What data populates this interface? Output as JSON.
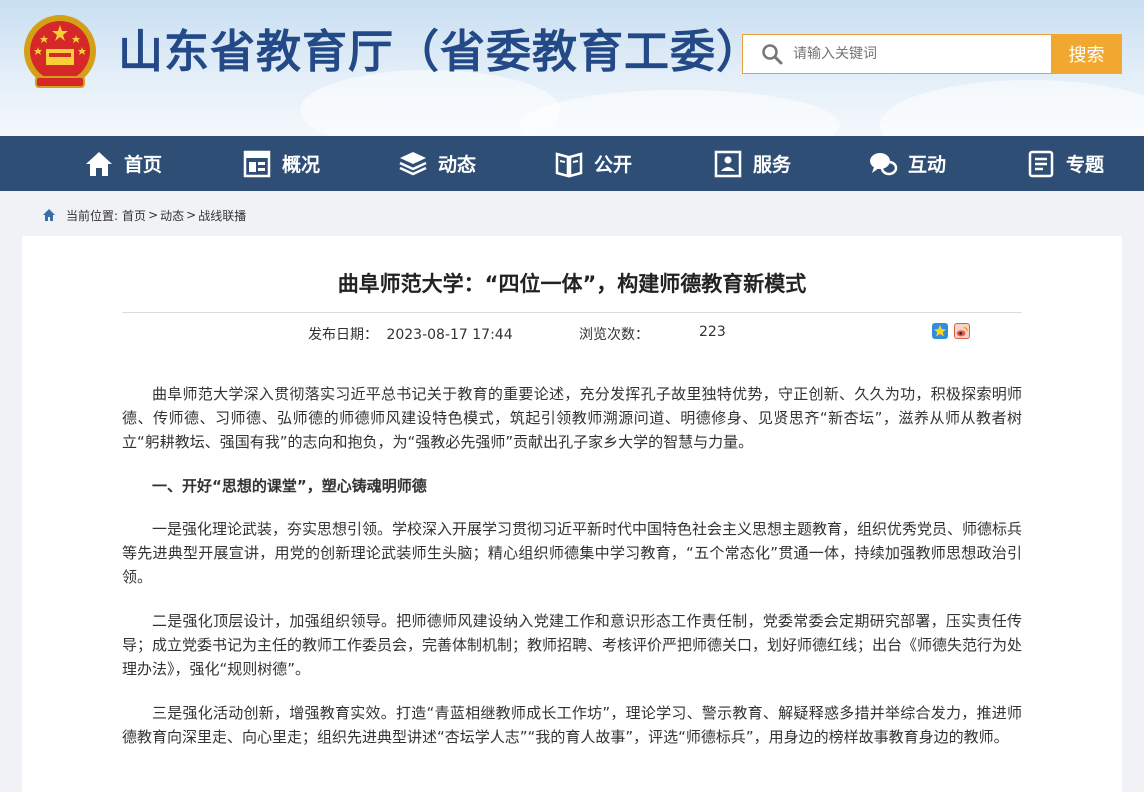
{
  "header": {
    "site_title": "山东省教育厅（省委教育工委）",
    "search": {
      "placeholder": "请输入关键词",
      "button_label": "搜索"
    }
  },
  "nav": {
    "items": [
      {
        "label": "首页",
        "icon": "home-icon"
      },
      {
        "label": "概况",
        "icon": "overview-icon"
      },
      {
        "label": "动态",
        "icon": "news-stack-icon"
      },
      {
        "label": "公开",
        "icon": "open-book-icon"
      },
      {
        "label": "服务",
        "icon": "service-doc-icon"
      },
      {
        "label": "互动",
        "icon": "chat-icon"
      },
      {
        "label": "专题",
        "icon": "topic-doc-icon"
      }
    ]
  },
  "breadcrumb": {
    "prefix": "当前位置:",
    "items": [
      "首页",
      "动态",
      "战线联播"
    ],
    "separator": ">"
  },
  "article": {
    "title": "曲阜师范大学：“四位一体”，构建师德教育新模式",
    "date_label": "发布日期：",
    "date": "2023-08-17 17:44",
    "views_label": "浏览次数：",
    "views": "223",
    "paragraphs": [
      {
        "type": "text",
        "text": "曲阜师范大学深入贯彻落实习近平总书记关于教育的重要论述，充分发挥孔子故里独特优势，守正创新、久久为功，积极探索明师德、传师德、习师德、弘师德的师德师风建设特色模式，筑起引领教师溯源问道、明德修身、见贤思齐“新杏坛”，滋养从师从教者树立“躬耕教坛、强国有我”的志向和抱负，为“强教必先强师”贡献出孔子家乡大学的智慧与力量。"
      },
      {
        "type": "heading",
        "text": "一、开好“思想的课堂”，塑心铸魂明师德"
      },
      {
        "type": "text",
        "text": "一是强化理论武装，夯实思想引领。学校深入开展学习贯彻习近平新时代中国特色社会主义思想主题教育，组织优秀党员、师德标兵等先进典型开展宣讲，用党的创新理论武装师生头脑；精心组织师德集中学习教育，“五个常态化”贯通一体，持续加强教师思想政治引领。"
      },
      {
        "type": "text",
        "text": "二是强化顶层设计，加强组织领导。把师德师风建设纳入党建工作和意识形态工作责任制，党委常委会定期研究部署，压实责任传导；成立党委书记为主任的教师工作委员会，完善体制机制；教师招聘、考核评价严把师德关口，划好师德红线；出台《师德失范行为处理办法》，强化“规则树德”。"
      },
      {
        "type": "text",
        "text": "三是强化活动创新，增强教育实效。打造“青蓝相继教师成长工作坊”，理论学习、警示教育、解疑释惑多措并举综合发力，推进师德教育向深里走、向心里走；组织先进典型讲述“杏坛学人志”“我的育人故事”，评选“师德标兵”，用身边的榜样故事教育身边的教师。"
      }
    ]
  },
  "colors": {
    "title_blue": "#234a86",
    "nav_bg": "#2f4e76",
    "search_button": "#f0a830"
  }
}
